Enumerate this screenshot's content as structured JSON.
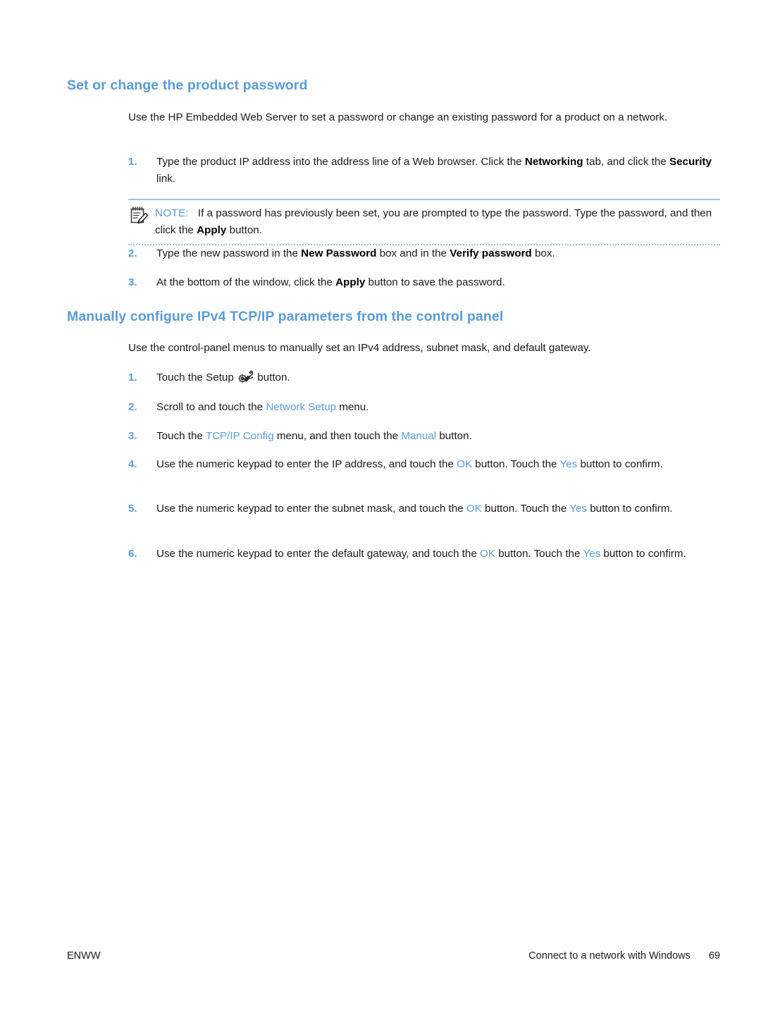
{
  "document": {
    "page_number": "69",
    "footer_left": "ENWW",
    "footer_chapter": "Connect to a network with Windows"
  },
  "colors": {
    "heading_blue": "#5b9bd5",
    "ui_term_blue": "#5b9bd5",
    "note_rule": "#9dc3e6",
    "body_text": "#1a1a1a"
  },
  "sections": [
    {
      "heading": "Set or change the product password",
      "intro": "Use the HP Embedded Web Server to set a password or change an existing password for a product on a network.",
      "steps": [
        {
          "num": "1.",
          "parts": [
            {
              "t": "Type the product IP address into the address line of a Web browser. Click the ",
              "s": "plain"
            },
            {
              "t": "Networking",
              "s": "bold"
            },
            {
              "t": " tab, and click the ",
              "s": "plain"
            },
            {
              "t": "Security",
              "s": "bold"
            },
            {
              "t": " link.",
              "s": "plain"
            }
          ]
        },
        {
          "num": "2.",
          "parts": [
            {
              "t": "Type the new password in the ",
              "s": "plain"
            },
            {
              "t": "New Password",
              "s": "bold"
            },
            {
              "t": " box and in the ",
              "s": "plain"
            },
            {
              "t": "Verify password",
              "s": "bold"
            },
            {
              "t": " box.",
              "s": "plain"
            }
          ]
        },
        {
          "num": "3.",
          "parts": [
            {
              "t": "At the bottom of the window, click the ",
              "s": "plain"
            },
            {
              "t": "Apply",
              "s": "bold"
            },
            {
              "t": " button to save the password.",
              "s": "plain"
            }
          ]
        }
      ],
      "note": {
        "icon": "note-pencil-icon",
        "label": "NOTE:",
        "parts": [
          {
            "t": "If a password has previously been set, you are prompted to type the password. Type the password, and then click the ",
            "s": "plain"
          },
          {
            "t": "Apply",
            "s": "bold"
          },
          {
            "t": " button.",
            "s": "plain"
          }
        ]
      }
    },
    {
      "heading": "Manually configure IPv4 TCP/IP parameters from the control panel",
      "intro": "Use the control-panel menus to manually set an IPv4 address, subnet mask, and default gateway.",
      "steps": [
        {
          "num": "1.",
          "parts": [
            {
              "t": "Touch the Setup ",
              "s": "plain"
            },
            {
              "t": "",
              "s": "icon",
              "icon": "setup-wrench-gear-icon"
            },
            {
              "t": " button.",
              "s": "plain"
            }
          ]
        },
        {
          "num": "2.",
          "parts": [
            {
              "t": "Scroll to and touch the ",
              "s": "plain"
            },
            {
              "t": "Network Setup",
              "s": "ui"
            },
            {
              "t": " menu.",
              "s": "plain"
            }
          ]
        },
        {
          "num": "3.",
          "parts": [
            {
              "t": "Touch the ",
              "s": "plain"
            },
            {
              "t": "TCP/IP Config",
              "s": "ui"
            },
            {
              "t": " menu, and then touch the ",
              "s": "plain"
            },
            {
              "t": "Manual",
              "s": "ui"
            },
            {
              "t": " button.",
              "s": "plain"
            }
          ]
        },
        {
          "num": "4.",
          "parts": [
            {
              "t": "Use the numeric keypad to enter the IP address, and touch the ",
              "s": "plain"
            },
            {
              "t": "OK",
              "s": "ui"
            },
            {
              "t": " button. Touch the ",
              "s": "plain"
            },
            {
              "t": "Yes",
              "s": "ui"
            },
            {
              "t": " button to confirm.",
              "s": "plain"
            }
          ]
        },
        {
          "num": "5.",
          "parts": [
            {
              "t": "Use the numeric keypad to enter the subnet mask, and touch the ",
              "s": "plain"
            },
            {
              "t": "OK",
              "s": "ui"
            },
            {
              "t": " button. Touch the ",
              "s": "plain"
            },
            {
              "t": "Yes",
              "s": "ui"
            },
            {
              "t": " button to confirm.",
              "s": "plain"
            }
          ]
        },
        {
          "num": "6.",
          "parts": [
            {
              "t": "Use the numeric keypad to enter the default gateway, and touch the ",
              "s": "plain"
            },
            {
              "t": "OK",
              "s": "ui"
            },
            {
              "t": " button. Touch the ",
              "s": "plain"
            },
            {
              "t": "Yes",
              "s": "ui"
            },
            {
              "t": " button to confirm.",
              "s": "plain"
            }
          ]
        }
      ]
    }
  ]
}
